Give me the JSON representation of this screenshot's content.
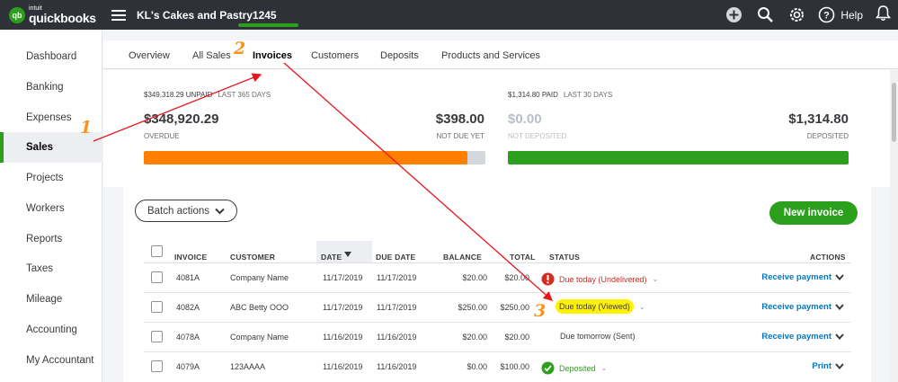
{
  "app": {
    "logo_intuit": "intuit",
    "logo_name": "quickbooks",
    "logo_badge": "qb",
    "company": "KL's Cakes and Pastry1245",
    "help_label": "Help"
  },
  "sidebar": {
    "items": [
      {
        "label": "Dashboard"
      },
      {
        "label": "Banking"
      },
      {
        "label": "Expenses"
      },
      {
        "label": "Sales",
        "active": true
      },
      {
        "label": "Projects"
      },
      {
        "label": "Workers"
      },
      {
        "label": "Reports"
      },
      {
        "label": "Taxes"
      },
      {
        "label": "Mileage"
      },
      {
        "label": "Accounting"
      },
      {
        "label": "My Accountant"
      }
    ]
  },
  "tabs": [
    {
      "label": "Overview"
    },
    {
      "label": "All Sales"
    },
    {
      "label": "Invoices",
      "active": true
    },
    {
      "label": "Customers"
    },
    {
      "label": "Deposits"
    },
    {
      "label": "Products and Services"
    }
  ],
  "summary": {
    "unpaid_amount": "$349,318.29 UNPAID",
    "unpaid_period": "LAST 365 DAYS",
    "overdue_value": "$348,920.29",
    "overdue_label": "OVERDUE",
    "not_due_value": "$398.00",
    "not_due_label": "NOT DUE YET",
    "paid_amount": "$1,314.80 PAID",
    "paid_period": "LAST 30 DAYS",
    "not_deposited_value": "$0.00",
    "not_deposited_label": "NOT DEPOSITED",
    "deposited_value": "$1,314.80",
    "deposited_label": "DEPOSITED",
    "overdue_fraction": 0.9989,
    "deposited_fraction": 1.0,
    "colors": {
      "overdue": "#ff8000",
      "deposited": "#2ca01c",
      "track": "#d4d7dc"
    }
  },
  "toolbar": {
    "batch_label": "Batch actions",
    "new_invoice_label": "New invoice"
  },
  "table": {
    "headers": {
      "invoice": "INVOICE",
      "customer": "CUSTOMER",
      "date": "DATE",
      "due_date": "DUE DATE",
      "balance": "BALANCE",
      "total": "TOTAL",
      "status": "STATUS",
      "actions": "ACTIONS"
    },
    "rows": [
      {
        "invoice": "4081A",
        "customer": "Company Name",
        "date": "11/17/2019",
        "due_date": "11/17/2019",
        "balance": "$20.00",
        "total": "$20.00",
        "status": "Due today (Undelivered)",
        "status_icon": "alert-icon",
        "action": "Receive payment"
      },
      {
        "invoice": "4082A",
        "customer": "ABC Betty OOO",
        "date": "11/17/2019",
        "due_date": "11/17/2019",
        "balance": "$250.00",
        "total": "$250.00",
        "status": "Due today (Viewed)",
        "status_icon": "",
        "action": "Receive payment"
      },
      {
        "invoice": "4078A",
        "customer": "Company Name",
        "date": "11/16/2019",
        "due_date": "11/16/2019",
        "balance": "$20.00",
        "total": "$20.00",
        "status": "Due tomorrow (Sent)",
        "status_icon": "",
        "action": "Receive payment"
      },
      {
        "invoice": "4079A",
        "customer": "123AAAA",
        "date": "11/16/2019",
        "due_date": "11/16/2019",
        "balance": "$0.00",
        "total": "$100.00",
        "status": "Deposited",
        "status_icon": "check-circle-icon",
        "action": "Print"
      }
    ]
  },
  "annotations": {
    "step1": "1",
    "step2": "2",
    "step3": "3",
    "color": "#f7931e",
    "arrow_color": "#e8151b",
    "highlight_color": "#fff200"
  }
}
